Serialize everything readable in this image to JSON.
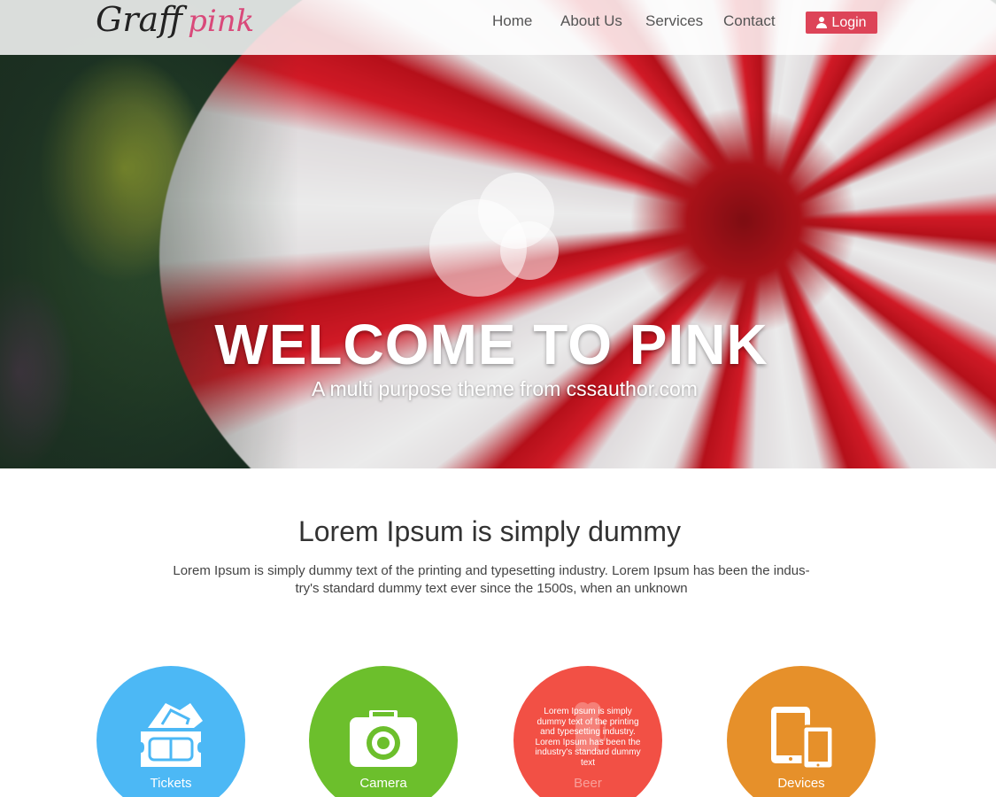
{
  "brand": {
    "logo_primary": "Graff",
    "logo_secondary": "pink",
    "accent": "#dd4458",
    "logo_accent": "#d9497a"
  },
  "nav": {
    "items": [
      {
        "label": "Home"
      },
      {
        "label": "About Us"
      },
      {
        "label": "Services"
      },
      {
        "label": "Contact"
      }
    ],
    "login_label": "Login",
    "login_icon": "user-icon"
  },
  "hero": {
    "title": "WELCOME TO PINK",
    "subtitle": "A multi purpose theme from cssauthor.com"
  },
  "intro": {
    "title": "Lorem Ipsum is simply dummy",
    "text_line1": "Lorem Ipsum is simply dummy text of the printing and typesetting industry. Lorem Ipsum has been the indus-",
    "text_line2": "try's standard dummy text ever since the 1500s, when an unknown"
  },
  "features": [
    {
      "label": "Tickets",
      "icon": "ticket-icon",
      "color": "#4cb8f5"
    },
    {
      "label": "Camera",
      "icon": "camera-icon",
      "color": "#6cbf2c"
    },
    {
      "label": "Beer",
      "icon": "beer-icon",
      "color": "#f25045",
      "hover_text": "Lorem Ipsum is simply dummy text of the printing and typesetting industry. Lorem Ipsum has been the industry's standard dummy text"
    },
    {
      "label": "Devices",
      "icon": "devices-icon",
      "color": "#e6902a"
    }
  ]
}
